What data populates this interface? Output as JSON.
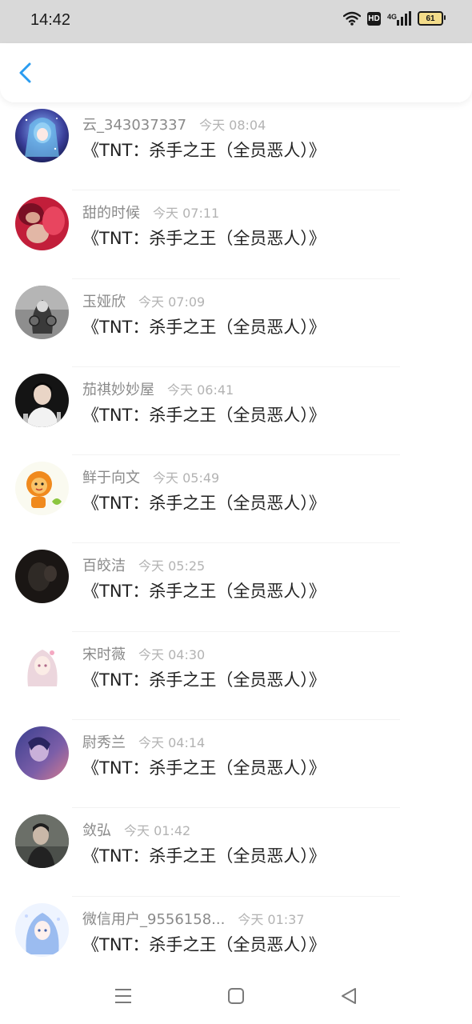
{
  "status_bar": {
    "time": "14:42",
    "hd_label": "HD",
    "network": "4G",
    "battery_level": "61"
  },
  "header": {
    "back_icon": "chevron-left-icon",
    "accent_color": "#2a9cf0"
  },
  "comments": [
    {
      "name": "云_343037337",
      "time": "今天 08:04",
      "text": "《TNT：杀手之王（全员恶人）》"
    },
    {
      "name": "甜的时候",
      "time": "今天 07:11",
      "text": "《TNT：杀手之王（全员恶人）》"
    },
    {
      "name": "玉娅欣",
      "time": "今天 07:09",
      "text": "《TNT：杀手之王（全员恶人）》"
    },
    {
      "name": "茄祺妙妙屋",
      "time": "今天 06:41",
      "text": "《TNT：杀手之王（全员恶人）》"
    },
    {
      "name": "鲜于向文",
      "time": "今天 05:49",
      "text": "《TNT：杀手之王（全员恶人）》"
    },
    {
      "name": "百皎洁",
      "time": "今天 05:25",
      "text": "《TNT：杀手之王（全员恶人）》"
    },
    {
      "name": "宋时薇",
      "time": "今天 04:30",
      "text": "《TNT：杀手之王（全员恶人）》"
    },
    {
      "name": "尉秀兰",
      "time": "今天 04:14",
      "text": "《TNT：杀手之王（全员恶人）》"
    },
    {
      "name": "敛弘",
      "time": "今天 01:42",
      "text": "《TNT：杀手之王（全员恶人）》"
    },
    {
      "name": "微信用户_9556158...",
      "time": "今天 01:37",
      "text": "《TNT：杀手之王（全员恶人）》"
    }
  ],
  "nav_bar": {
    "buttons": [
      "menu-icon",
      "home-square-icon",
      "back-triangle-icon"
    ]
  }
}
